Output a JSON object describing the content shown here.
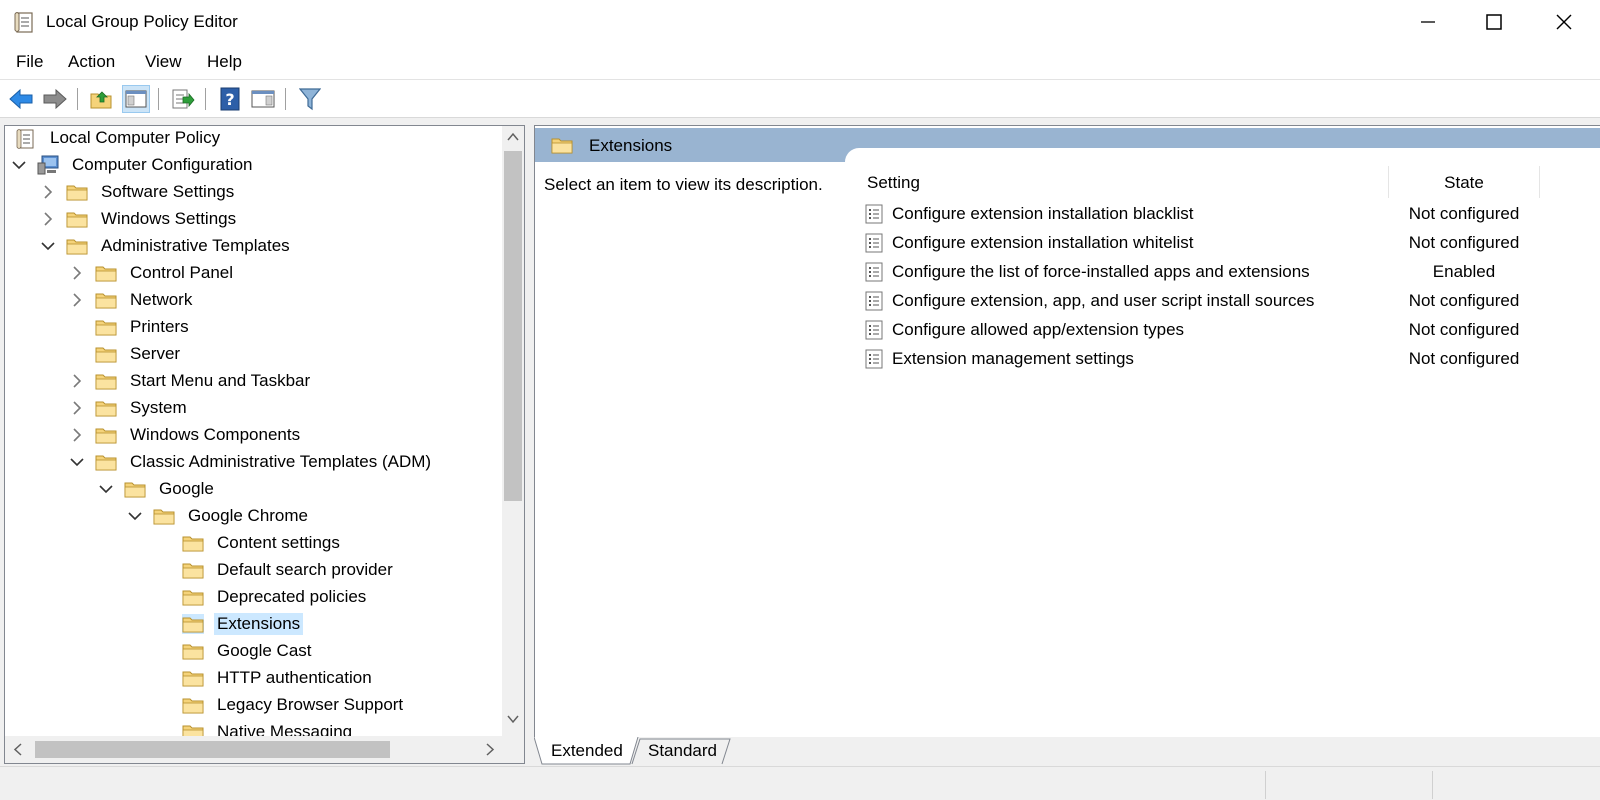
{
  "window": {
    "title": "Local Group Policy Editor"
  },
  "menu": [
    "File",
    "Action",
    "View",
    "Help"
  ],
  "tree": [
    {
      "label": "Local Computer Policy",
      "icon": "policy-doc-icon",
      "expander": "none"
    },
    {
      "label": "Computer Configuration",
      "icon": "computer-icon",
      "expander": "expanded"
    },
    {
      "label": "Software Settings",
      "icon": "folder-icon",
      "expander": "collapsed"
    },
    {
      "label": "Windows Settings",
      "icon": "folder-icon",
      "expander": "collapsed"
    },
    {
      "label": "Administrative Templates",
      "icon": "folder-icon",
      "expander": "expanded"
    },
    {
      "label": "Control Panel",
      "icon": "folder-icon",
      "expander": "collapsed"
    },
    {
      "label": "Network",
      "icon": "folder-icon",
      "expander": "collapsed"
    },
    {
      "label": "Printers",
      "icon": "folder-icon",
      "expander": "none"
    },
    {
      "label": "Server",
      "icon": "folder-icon",
      "expander": "none"
    },
    {
      "label": "Start Menu and Taskbar",
      "icon": "folder-icon",
      "expander": "collapsed"
    },
    {
      "label": "System",
      "icon": "folder-icon",
      "expander": "collapsed"
    },
    {
      "label": "Windows Components",
      "icon": "folder-icon",
      "expander": "collapsed"
    },
    {
      "label": "Classic Administrative Templates (ADM)",
      "icon": "folder-icon",
      "expander": "expanded"
    },
    {
      "label": "Google",
      "icon": "folder-icon",
      "expander": "expanded"
    },
    {
      "label": "Google Chrome",
      "icon": "folder-icon",
      "expander": "expanded"
    },
    {
      "label": "Content settings",
      "icon": "folder-icon",
      "expander": "none"
    },
    {
      "label": "Default search provider",
      "icon": "folder-icon",
      "expander": "none"
    },
    {
      "label": "Deprecated policies",
      "icon": "folder-icon",
      "expander": "none"
    },
    {
      "label": "Extensions",
      "icon": "folder-icon",
      "expander": "none",
      "selected": true
    },
    {
      "label": "Google Cast",
      "icon": "folder-icon",
      "expander": "none"
    },
    {
      "label": "HTTP authentication",
      "icon": "folder-icon",
      "expander": "none"
    },
    {
      "label": "Legacy Browser Support",
      "icon": "folder-icon",
      "expander": "none"
    },
    {
      "label": "Native Messaging",
      "icon": "folder-icon",
      "expander": "none"
    }
  ],
  "details": {
    "header": "Extensions",
    "description": "Select an item to view its description.",
    "columns": {
      "setting": "Setting",
      "state": "State"
    },
    "settings": [
      {
        "name": "Configure extension installation blacklist",
        "state": "Not configured"
      },
      {
        "name": "Configure extension installation whitelist",
        "state": "Not configured"
      },
      {
        "name": "Configure the list of force-installed apps and extensions",
        "state": "Enabled"
      },
      {
        "name": "Configure extension, app, and user script install sources",
        "state": "Not configured"
      },
      {
        "name": "Configure allowed app/extension types",
        "state": "Not configured"
      },
      {
        "name": "Extension management settings",
        "state": "Not configured"
      }
    ]
  },
  "tabs": [
    "Extended",
    "Standard"
  ],
  "toolbar": [
    "back-icon",
    "forward-icon",
    "up-folder-icon",
    "show-hide-tree-icon",
    "export-list-icon",
    "help-icon",
    "show-hide-action-pane-icon",
    "filter-icon"
  ],
  "colors": {
    "header": "#99b4d1",
    "selection": "#cce8ff",
    "folder": "#f5d37a"
  }
}
